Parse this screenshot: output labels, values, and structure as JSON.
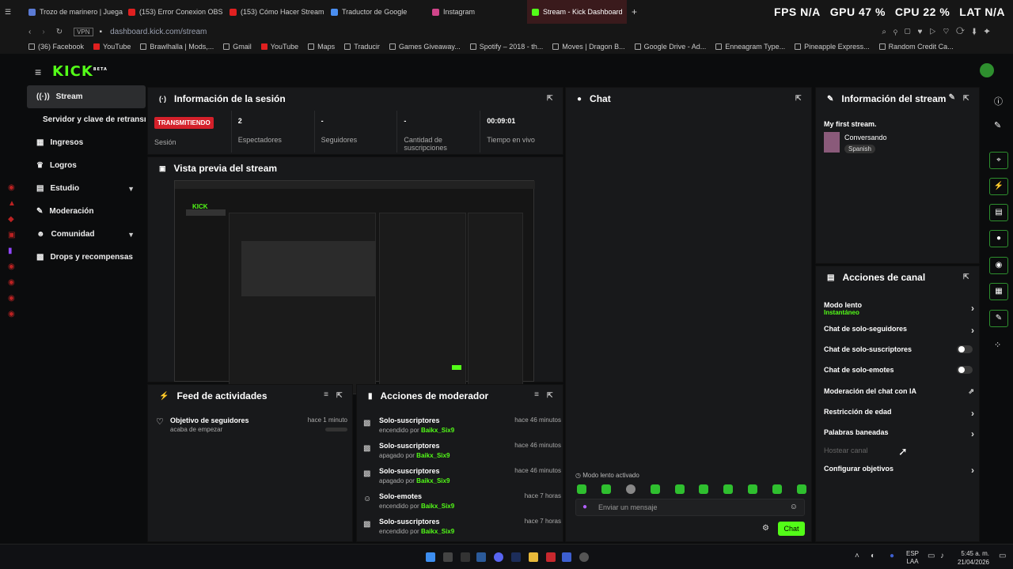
{
  "browser": {
    "tabs": [
      {
        "label": "Trozo de marinero | Juega",
        "color": "#5b7bd5"
      },
      {
        "label": "(153) Error Conexion OBS",
        "color": "#e02020"
      },
      {
        "label": "(153) Cómo Hacer Stream",
        "color": "#e02020"
      },
      {
        "label": "Traductor de Google",
        "color": "#4a8ef0"
      },
      {
        "label": "Instagram",
        "color": "#d0458a"
      },
      {
        "label": "Stream - Kick Dashboard",
        "color": "#53fc18"
      }
    ],
    "stats": {
      "fps_label": "FPS",
      "fps": "N/A",
      "gpu_label": "GPU",
      "gpu": "47 %",
      "cpu_label": "CPU",
      "cpu": "22 %",
      "lat_label": "LAT",
      "lat": "N/A"
    },
    "url": "dashboard.kick.com/stream",
    "vpn": "VPN",
    "bookmarks": [
      "(36) Facebook",
      "YouTube",
      "Brawlhalla | Mods,...",
      "Gmail",
      "YouTube",
      "Maps",
      "Traducir",
      "Games Giveaway...",
      "Spotify – 2018 - th...",
      "Moves | Dragon B...",
      "Google Drive - Ad...",
      "Enneagram Type...",
      "Pineapple Express...",
      "Random Credit Ca..."
    ]
  },
  "app": {
    "logo": "KICK",
    "logo_sup": "BETA"
  },
  "sidebar": {
    "items": [
      {
        "label": "Stream",
        "icon": "broadcast-icon"
      },
      {
        "label": "Servidor y clave de retransmisión",
        "icon": ""
      },
      {
        "label": "Ingresos",
        "icon": "money-icon"
      },
      {
        "label": "Logros",
        "icon": "trophy-icon"
      },
      {
        "label": "Estudio",
        "icon": "studio-icon"
      },
      {
        "label": "Moderación",
        "icon": "wrench-icon"
      },
      {
        "label": "Comunidad",
        "icon": "people-icon"
      },
      {
        "label": "Drops y recompensas",
        "icon": "gift-icon"
      }
    ]
  },
  "session": {
    "title": "Información de la sesión",
    "status": "TRANSMITIENDO",
    "status_label": "Sesión",
    "viewers": "2",
    "viewers_label": "Espectadores",
    "followers": "-",
    "followers_label": "Seguidores",
    "subs": "-",
    "subs_label": "Cantidad de suscripciones",
    "time": "00:09:01",
    "time_label": "Tiempo en vivo"
  },
  "preview": {
    "title": "Vista previa del stream"
  },
  "chat": {
    "title": "Chat",
    "slow_mode": "Modo lento activado",
    "placeholder": "Enviar un mensaje",
    "send": "Chat"
  },
  "stream_info": {
    "title": "Información del stream",
    "stream_title": "My first stream.",
    "category": "Conversando",
    "language": "Spanish"
  },
  "feed": {
    "title": "Feed de actividades",
    "items": [
      {
        "title": "Objetivo de seguidores",
        "sub": "acaba de empezar",
        "time": "hace 1 minuto"
      }
    ]
  },
  "mod_actions": {
    "title": "Acciones de moderador",
    "rows": [
      {
        "title": "Solo-suscriptores",
        "action": "encendido por",
        "user": "Baikx_Six9",
        "time": "hace 46 minutos",
        "icon": "gift-icon"
      },
      {
        "title": "Solo-suscriptores",
        "action": "apagado por",
        "user": "Baikx_Six9",
        "time": "hace 46 minutos",
        "icon": "gift-icon"
      },
      {
        "title": "Solo-suscriptores",
        "action": "apagado por",
        "user": "Baikx_Six9",
        "time": "hace 46 minutos",
        "icon": "gift-icon"
      },
      {
        "title": "Solo-emotes",
        "action": "encendido por",
        "user": "Baikx_Six9",
        "time": "hace 7 horas",
        "icon": "emote-icon"
      },
      {
        "title": "Solo-suscriptores",
        "action": "encendido por",
        "user": "Baikx_Six9",
        "time": "hace 7 horas",
        "icon": "gift-icon"
      }
    ]
  },
  "channel_actions": {
    "title": "Acciones de canal",
    "slow_mode": "Modo lento",
    "slow_mode_value": "Instantáneo",
    "items": [
      {
        "label": "Chat de solo-seguidores",
        "control": "chevron"
      },
      {
        "label": "Chat de solo-suscriptores",
        "control": "toggle"
      },
      {
        "label": "Chat de solo-emotes",
        "control": "toggle"
      },
      {
        "label": "Moderación del chat con IA",
        "control": "external"
      },
      {
        "label": "Restricción de edad",
        "control": "chevron"
      },
      {
        "label": "Palabras baneadas",
        "control": "chevron"
      }
    ],
    "host": "Hostear canal",
    "goals": "Configurar objetivos"
  },
  "taskbar": {
    "lang": "ESP",
    "lang2": "LAA",
    "time": "5:45 a. m.",
    "date": "21/04/2026"
  },
  "colors": {
    "accent": "#53fc18",
    "live": "#d4202a",
    "panel": "#18191b"
  }
}
